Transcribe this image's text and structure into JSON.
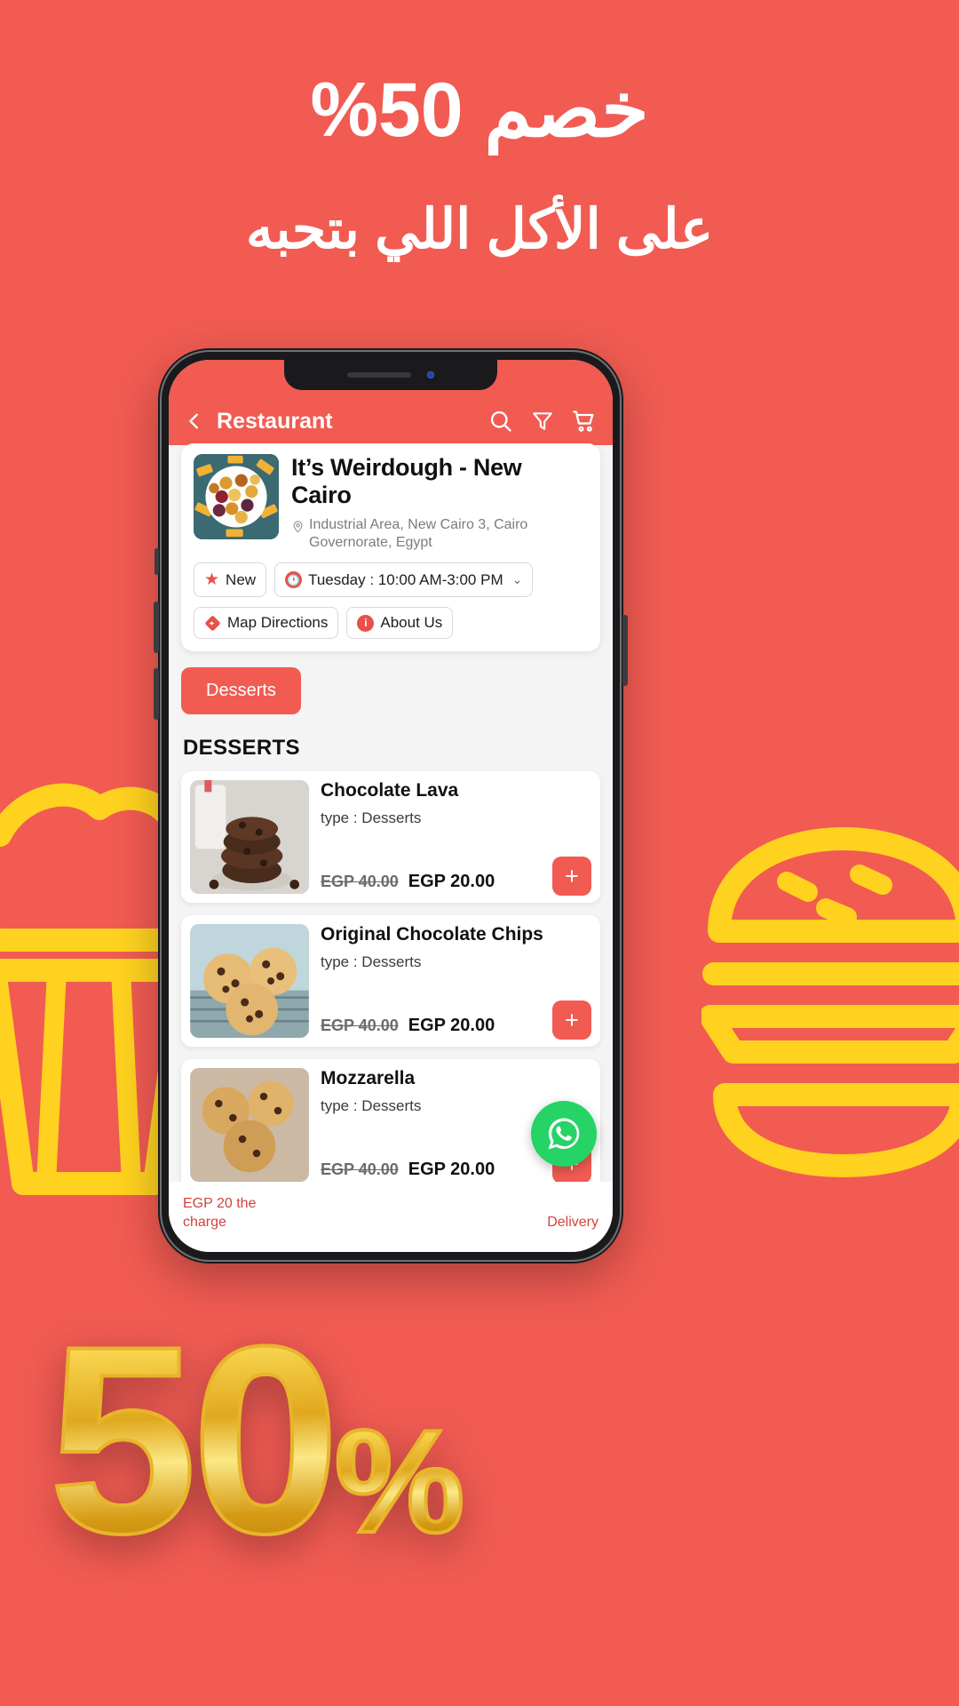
{
  "poster": {
    "background_color": "#f15b52",
    "headline_line1": "خصم 50%",
    "headline_line2": "على الأكل اللي بتحبه",
    "gold_badge_number": "50",
    "gold_badge_percent": "%"
  },
  "app": {
    "header": {
      "back_icon": "chevron-left-icon",
      "title": "Restaurant",
      "icons": [
        "search-icon",
        "filter-icon",
        "cart-icon"
      ]
    },
    "restaurant": {
      "name": "It’s Weirdough - New Cairo",
      "address": "Industrial Area, New Cairo 3, Cairo Governorate, Egypt",
      "location_icon": "map-pin-icon",
      "chips": [
        {
          "icon": "star-icon",
          "label": "New"
        },
        {
          "icon": "clock-icon",
          "label": "Tuesday : 10:00 AM-3:00 PM",
          "has_chevron": true
        },
        {
          "icon": "directions-icon",
          "label": "Map Directions"
        },
        {
          "icon": "info-icon",
          "label": "About Us"
        }
      ]
    },
    "categories": [
      {
        "label": "Desserts",
        "active": true
      }
    ],
    "section_title": "DESSERTS",
    "menu_items": [
      {
        "name": "Chocolate Lava",
        "type": "type : Desserts",
        "price_old": "EGP 40.00",
        "price_new": "EGP 20.00",
        "add_label": "+"
      },
      {
        "name": "Original Chocolate Chips",
        "type": "type : Desserts",
        "price_old": "EGP 40.00",
        "price_new": "EGP 20.00",
        "add_label": "+"
      },
      {
        "name": "Mozzarella",
        "type": "type : Desserts",
        "price_old": "EGP 40.00",
        "price_new": "EGP 20.00",
        "add_label": "+"
      }
    ],
    "footer": {
      "left_line1": "EGP 20 the",
      "left_line2": "charge",
      "right_text": "Delivery"
    },
    "whatsapp_fab": "whatsapp-icon"
  },
  "colors": {
    "brand_red": "#f15b52",
    "accent_red": "#e8504a",
    "gold": "#e8b52a",
    "whatsapp_green": "#25d366"
  }
}
